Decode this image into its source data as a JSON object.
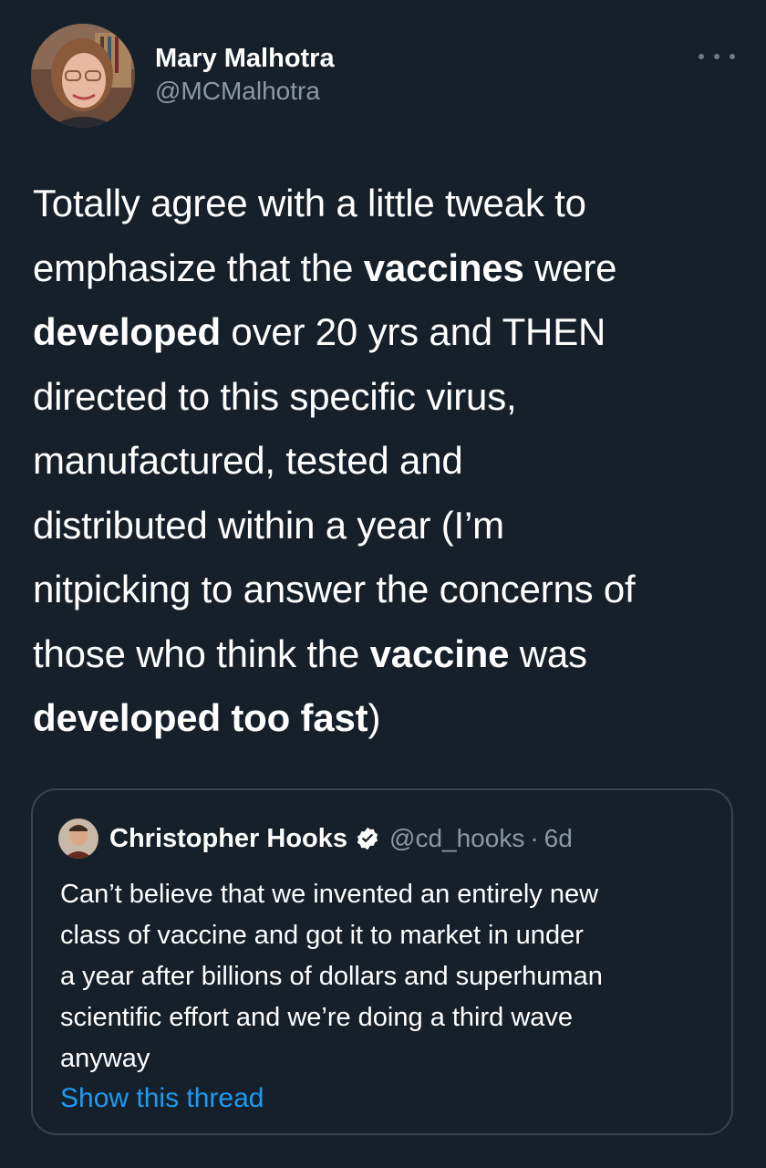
{
  "author": {
    "name": "Mary Malhotra",
    "handle": "@MCMalhotra"
  },
  "tweet": {
    "lines": [
      [
        {
          "t": "Totally agree with a little tweak to",
          "b": false
        }
      ],
      [
        {
          "t": "emphasize that the ",
          "b": false
        },
        {
          "t": "vaccines",
          "b": true
        },
        {
          "t": " were",
          "b": false
        }
      ],
      [
        {
          "t": "developed",
          "b": true
        },
        {
          "t": " over 20 yrs and THEN",
          "b": false
        }
      ],
      [
        {
          "t": "directed to this specific virus,",
          "b": false
        }
      ],
      [
        {
          "t": "manufactured, tested and",
          "b": false
        }
      ],
      [
        {
          "t": "distributed within a year (I’m",
          "b": false
        }
      ],
      [
        {
          "t": "nitpicking to answer the concerns of",
          "b": false
        }
      ],
      [
        {
          "t": "those who think the ",
          "b": false
        },
        {
          "t": "vaccine",
          "b": true
        },
        {
          "t": " was",
          "b": false
        }
      ],
      [
        {
          "t": "developed too fast",
          "b": true
        },
        {
          "t": ")",
          "b": false
        }
      ]
    ]
  },
  "quoted_tweet": {
    "name": "Christopher Hooks",
    "handle": "@cd_hooks",
    "separator": "·",
    "time": "6d",
    "lines": [
      "Can’t believe that we invented an entirely new",
      "class of vaccine and got it to market in under",
      "a year after billions of dollars and superhuman",
      "scientific effort and we’re doing a third wave",
      "anyway"
    ],
    "show_thread": "Show this thread"
  },
  "icons": {
    "more": "more-horizontal-icon",
    "verified": "verified-badge-icon"
  },
  "colors": {
    "background": "#15202b",
    "text": "#ffffff",
    "secondary": "#8b98a5",
    "link": "#1d9bf0",
    "border": "#38444d"
  }
}
